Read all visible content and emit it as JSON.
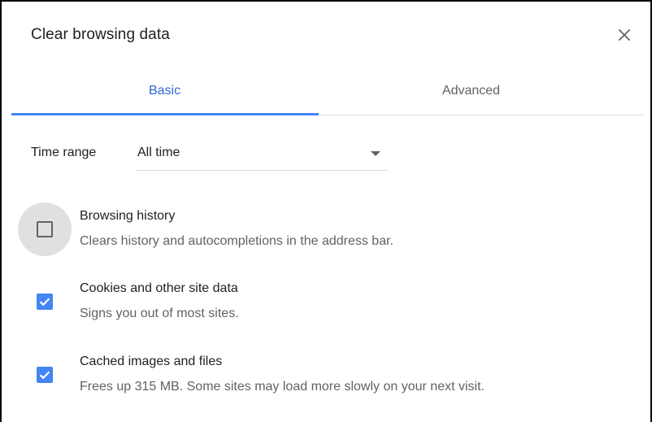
{
  "dialog": {
    "title": "Clear browsing data",
    "close_icon": "close-icon"
  },
  "tabs": [
    {
      "label": "Basic",
      "active": true
    },
    {
      "label": "Advanced",
      "active": false
    }
  ],
  "time_range": {
    "label": "Time range",
    "selected": "All time"
  },
  "options": [
    {
      "title": "Browsing history",
      "description": "Clears history and autocompletions in the address bar.",
      "checked": false
    },
    {
      "title": "Cookies and other site data",
      "description": "Signs you out of most sites.",
      "checked": true
    },
    {
      "title": "Cached images and files",
      "description": "Frees up 315 MB. Some sites may load more slowly on your next visit.",
      "checked": true
    }
  ],
  "colors": {
    "accent": "#4285f4",
    "active_tab_text": "#3367d6",
    "secondary_text": "#5f6368"
  }
}
